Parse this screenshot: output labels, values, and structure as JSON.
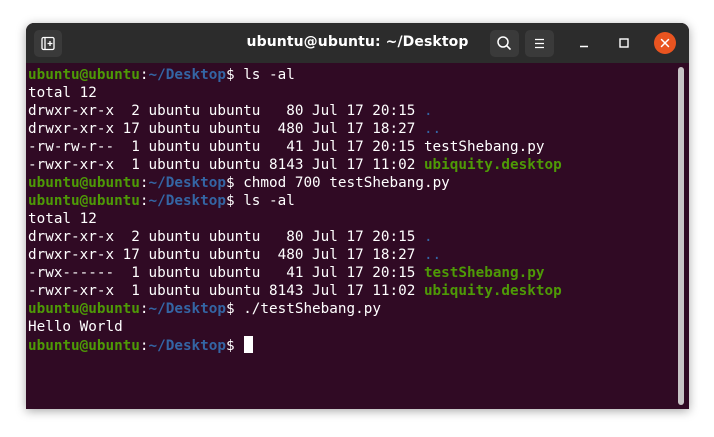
{
  "window": {
    "title": "ubuntu@ubuntu: ~/Desktop"
  },
  "icons": {
    "new_tab": "new-tab-icon",
    "search": "search-icon",
    "menu": "hamburger-menu-icon",
    "minimize": "minimize-icon",
    "maximize": "maximize-icon",
    "close": "close-icon"
  },
  "colors": {
    "terminal_bg": "#300a24",
    "titlebar_bg": "#2c2c2c",
    "prompt_user": "#4e9a06",
    "prompt_path": "#3465a4",
    "executable": "#4e9a06",
    "directory": "#3465a4",
    "close_button": "#e95420"
  },
  "terminal": {
    "prompt_user": "ubuntu@ubuntu",
    "prompt_sep": ":",
    "prompt_path": "~/Desktop",
    "prompt_symbol": "$",
    "lines": [
      {
        "kind": "prompt",
        "command": " ls -al"
      },
      {
        "kind": "text",
        "text": "total 12"
      },
      {
        "kind": "file",
        "meta": "drwxr-xr-x  2 ubuntu ubuntu   80 Jul 17 20:15 ",
        "name": ".",
        "style": "dir"
      },
      {
        "kind": "file",
        "meta": "drwxr-xr-x 17 ubuntu ubuntu  480 Jul 17 18:27 ",
        "name": "..",
        "style": "dir"
      },
      {
        "kind": "file",
        "meta": "-rw-rw-r--  1 ubuntu ubuntu   41 Jul 17 20:15 ",
        "name": "testShebang.py",
        "style": "plain"
      },
      {
        "kind": "file",
        "meta": "-rwxr-xr-x  1 ubuntu ubuntu 8143 Jul 17 11:02 ",
        "name": "ubiquity.desktop",
        "style": "exec"
      },
      {
        "kind": "prompt",
        "command": " chmod 700 testShebang.py"
      },
      {
        "kind": "prompt",
        "command": " ls -al"
      },
      {
        "kind": "text",
        "text": "total 12"
      },
      {
        "kind": "file",
        "meta": "drwxr-xr-x  2 ubuntu ubuntu   80 Jul 17 20:15 ",
        "name": ".",
        "style": "dir"
      },
      {
        "kind": "file",
        "meta": "drwxr-xr-x 17 ubuntu ubuntu  480 Jul 17 18:27 ",
        "name": "..",
        "style": "dir"
      },
      {
        "kind": "file",
        "meta": "-rwx------  1 ubuntu ubuntu   41 Jul 17 20:15 ",
        "name": "testShebang.py",
        "style": "exec"
      },
      {
        "kind": "file",
        "meta": "-rwxr-xr-x  1 ubuntu ubuntu 8143 Jul 17 11:02 ",
        "name": "ubiquity.desktop",
        "style": "exec"
      },
      {
        "kind": "prompt",
        "command": " ./testShebang.py"
      },
      {
        "kind": "text",
        "text": "Hello World"
      },
      {
        "kind": "prompt",
        "command": "",
        "cursor": true
      }
    ]
  }
}
